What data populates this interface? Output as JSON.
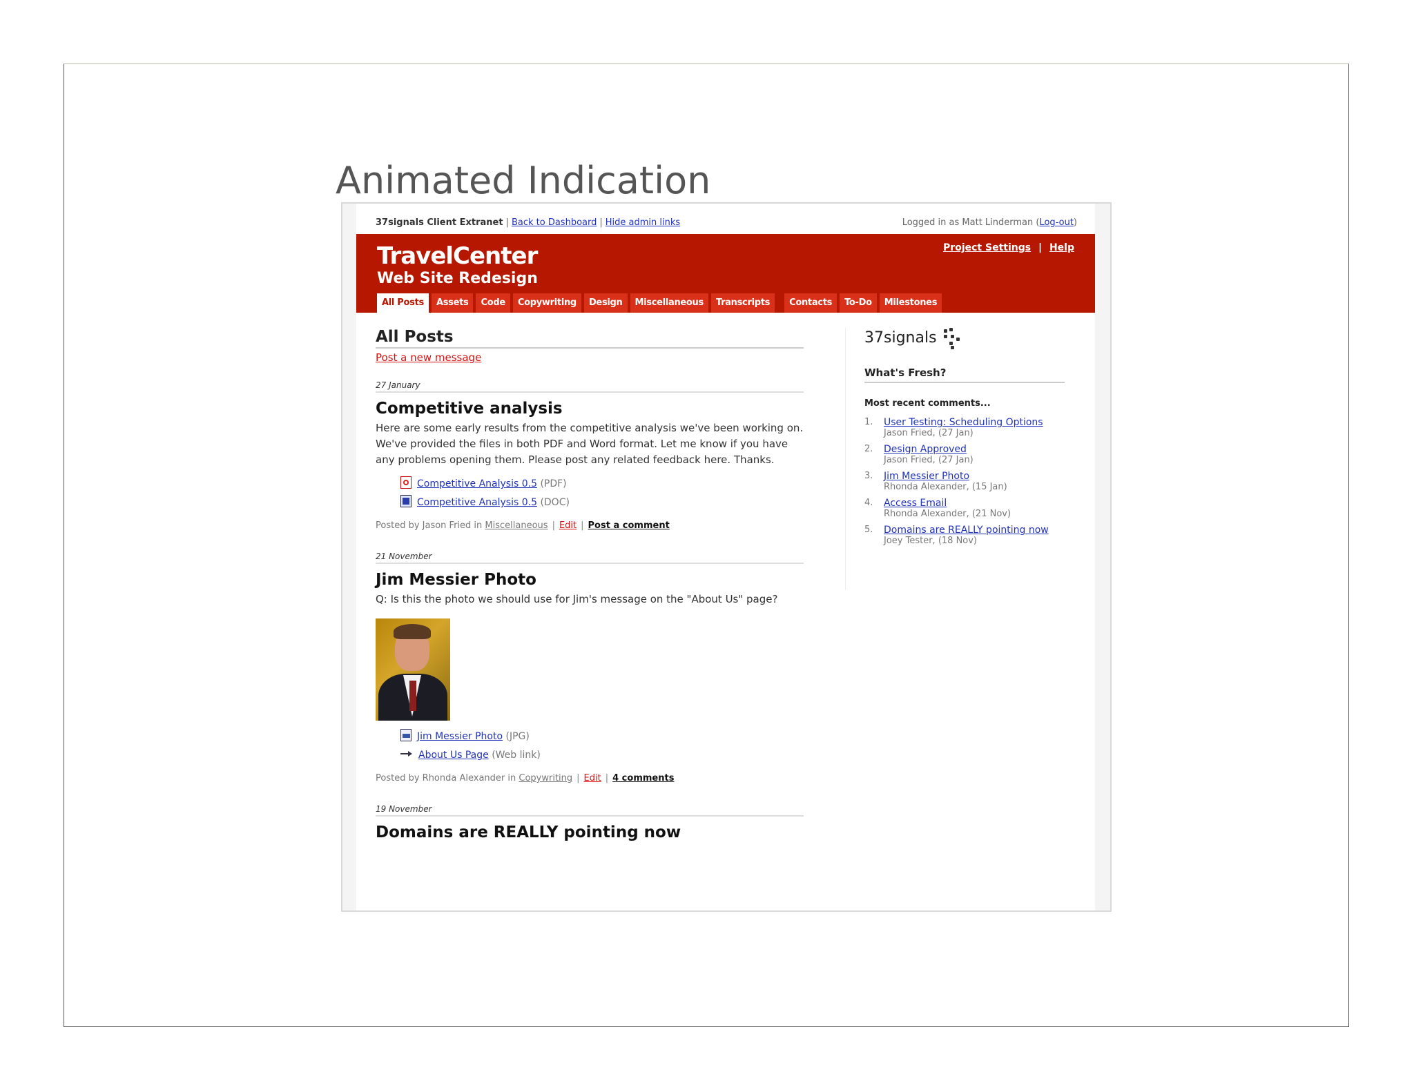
{
  "slide": {
    "title": "Animated Indication"
  },
  "topbar": {
    "app_name": "37signals Client Extranet",
    "back_link": "Back to Dashboard",
    "hide_link": "Hide admin links",
    "logged_in": "Logged in as Matt Linderman (",
    "logout": "Log-out",
    "close_paren": ")"
  },
  "header": {
    "brand": "TravelCenter",
    "project": "Web Site Redesign",
    "settings_link": "Project Settings",
    "help_link": "Help",
    "divider": "|"
  },
  "tabs": [
    "All Posts",
    "Assets",
    "Code",
    "Copywriting",
    "Design",
    "Miscellaneous",
    "Transcripts",
    "Contacts",
    "To-Do",
    "Milestones"
  ],
  "main": {
    "heading": "All Posts",
    "post_new": "Post a new message",
    "posts": [
      {
        "date": "27 January",
        "title": "Competitive analysis",
        "body": "Here are some early results from the competitive analysis we've been working on. We've provided the files in both PDF and Word format. Let me know if you have any problems opening them. Please post any related feedback here. Thanks.",
        "attachments": [
          {
            "name": "Competitive Analysis 0.5",
            "type": "(PDF)"
          },
          {
            "name": "Competitive Analysis 0.5",
            "type": "(DOC)"
          }
        ],
        "posted_by": "Posted by Jason Fried in",
        "category": "Miscellaneous",
        "edit": "Edit",
        "action": "Post a comment"
      },
      {
        "date": "21 November",
        "title": "Jim Messier Photo",
        "body": "Q: Is this the photo we should use for Jim's message on the \"About Us\" page?",
        "attachments": [
          {
            "name": "Jim Messier Photo",
            "type": "(JPG)"
          },
          {
            "name": "About Us Page",
            "type": "(Web link)"
          }
        ],
        "posted_by": "Posted by Rhonda Alexander in",
        "category": "Copywriting",
        "edit": "Edit",
        "action": "4 comments"
      },
      {
        "date": "19 November",
        "title": "Domains are REALLY pointing now"
      }
    ]
  },
  "sidebar": {
    "logo": "37signals",
    "fresh_heading": "What's Fresh?",
    "recent_heading": "Most recent comments...",
    "recent": [
      {
        "num": "1.",
        "title": "User Testing: Scheduling Options",
        "who": "Jason Fried, (27 Jan)"
      },
      {
        "num": "2.",
        "title": "Design Approved",
        "who": "Jason Fried, (27 Jan)"
      },
      {
        "num": "3.",
        "title": "Jim Messier Photo",
        "who": "Rhonda Alexander, (15 Jan)"
      },
      {
        "num": "4.",
        "title": "Access Email",
        "who": "Rhonda Alexander, (21 Nov)"
      },
      {
        "num": "5.",
        "title": "Domains are REALLY pointing now",
        "who": "Joey Tester, (18 Nov)"
      }
    ]
  },
  "colors": {
    "header_red": "#b51700",
    "tab_red": "#d9301a",
    "link_blue": "#2233bb",
    "alert_red": "#dd1111"
  }
}
